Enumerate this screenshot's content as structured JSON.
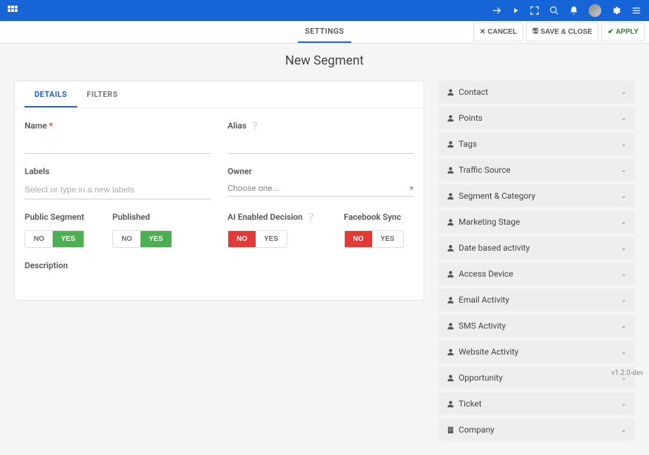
{
  "subbar": {
    "tab": "SETTINGS",
    "cancel": "CANCEL",
    "save_close": "SAVE & CLOSE",
    "apply": "APPLY"
  },
  "page_title": "New Segment",
  "tabs": {
    "details": "DETAILS",
    "filters": "FILTERS"
  },
  "form": {
    "name_label": "Name",
    "alias_label": "Alias",
    "labels_label": "Labels",
    "labels_placeholder": "Select or type in a new labels",
    "owner_label": "Owner",
    "owner_placeholder": "Choose one...",
    "public_segment_label": "Public Segment",
    "published_label": "Published",
    "ai_label": "AI Enabled Decision",
    "fb_label": "Facebook Sync",
    "description_label": "Description",
    "no": "NO",
    "yes": "YES"
  },
  "sidebar": {
    "items": [
      {
        "label": "Contact",
        "icon": "person"
      },
      {
        "label": "Points",
        "icon": "person"
      },
      {
        "label": "Tags",
        "icon": "person"
      },
      {
        "label": "Traffic Source",
        "icon": "person"
      },
      {
        "label": "Segment & Category",
        "icon": "person"
      },
      {
        "label": "Marketing Stage",
        "icon": "person"
      },
      {
        "label": "Date based activity",
        "icon": "person"
      },
      {
        "label": "Access Device",
        "icon": "person"
      },
      {
        "label": "Email Activity",
        "icon": "person"
      },
      {
        "label": "SMS Activity",
        "icon": "person"
      },
      {
        "label": "Website Activity",
        "icon": "person"
      },
      {
        "label": "Opportunity",
        "icon": "person"
      },
      {
        "label": "Ticket",
        "icon": "person"
      },
      {
        "label": "Company",
        "icon": "building"
      }
    ]
  },
  "version": "v1.2.0-dev"
}
